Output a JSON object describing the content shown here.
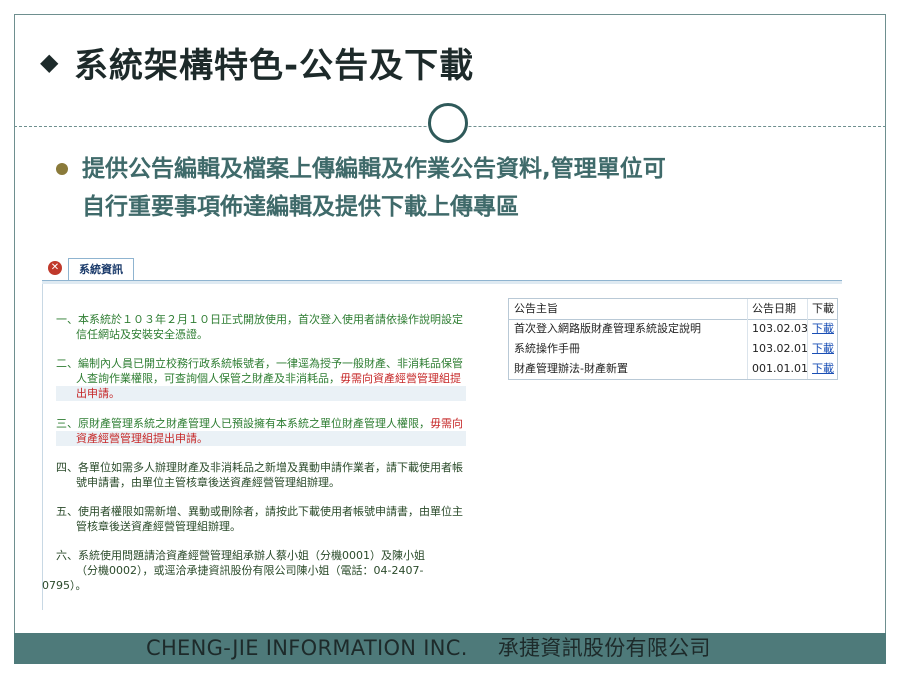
{
  "slide": {
    "title": "系統架構特色-公告及下載",
    "bullet_line1": "提供公告編輯及檔案上傳編輯及作業公告資料,管理單位可",
    "bullet_line2": "自行重要事項佈達編輯及提供下載上傳專區",
    "footer_company_en": "CHENG-JIE  INFORMATION  INC.",
    "footer_company_zh": "承捷資訊股份有限公司"
  },
  "screenshot": {
    "tab_label": "系統資訊",
    "notices": [
      {
        "line1": "一、本系統於１０３年２月１０日正式開放使用，首次登入使用者請依操作說明設定",
        "line2": "信任網站及安裝安全憑證。"
      },
      {
        "line1": "二、編制內人員已開立校務行政系統帳號者，一律逕為授予一般財產、非消耗品保管",
        "line2a": "人查詢作業權限，可查詢個人保管之財產及非消耗品，",
        "line2b": "毋需向資產經營管理組提",
        "line3": "出申請。"
      },
      {
        "line1a": "三、原財產管理系統之財產管理人已預設擁有本系統之單位財產管理人權限，",
        "line1b": "毋需向",
        "line2": "資產經營管理組提出申請。"
      },
      {
        "line1": "四、各單位如需多人辦理財產及非消耗品之新增及異動申請作業者，請下載使用者帳",
        "line2": "號申請書，由單位主管核章後送資產經營管理組辦理。"
      },
      {
        "line1": "五、使用者權限如需新增、異動或刪除者，請按此下載使用者帳號申請書，由單位主",
        "line2": "管核章後送資產經營管理組辦理。"
      },
      {
        "line1": "六、系統使用問題請洽資產經營管理組承辦人蔡小姐（分機0001）及陳小姐",
        "line2": "（分機0002），或逕洽承捷資訊股份有限公司陳小姐（電話：04-2407-",
        "line3": "0795）。"
      }
    ],
    "table": {
      "headers": [
        "公告主旨",
        "公告日期",
        "下載"
      ],
      "rows": [
        {
          "subject": "首次登入網路版財產管理系統設定說明",
          "date": "103.02.03",
          "download": "下載"
        },
        {
          "subject": "系統操作手冊",
          "date": "103.02.01",
          "download": "下載"
        },
        {
          "subject": "財產管理辦法-財產新置",
          "date": "001.01.01",
          "download": "下載"
        }
      ]
    }
  }
}
